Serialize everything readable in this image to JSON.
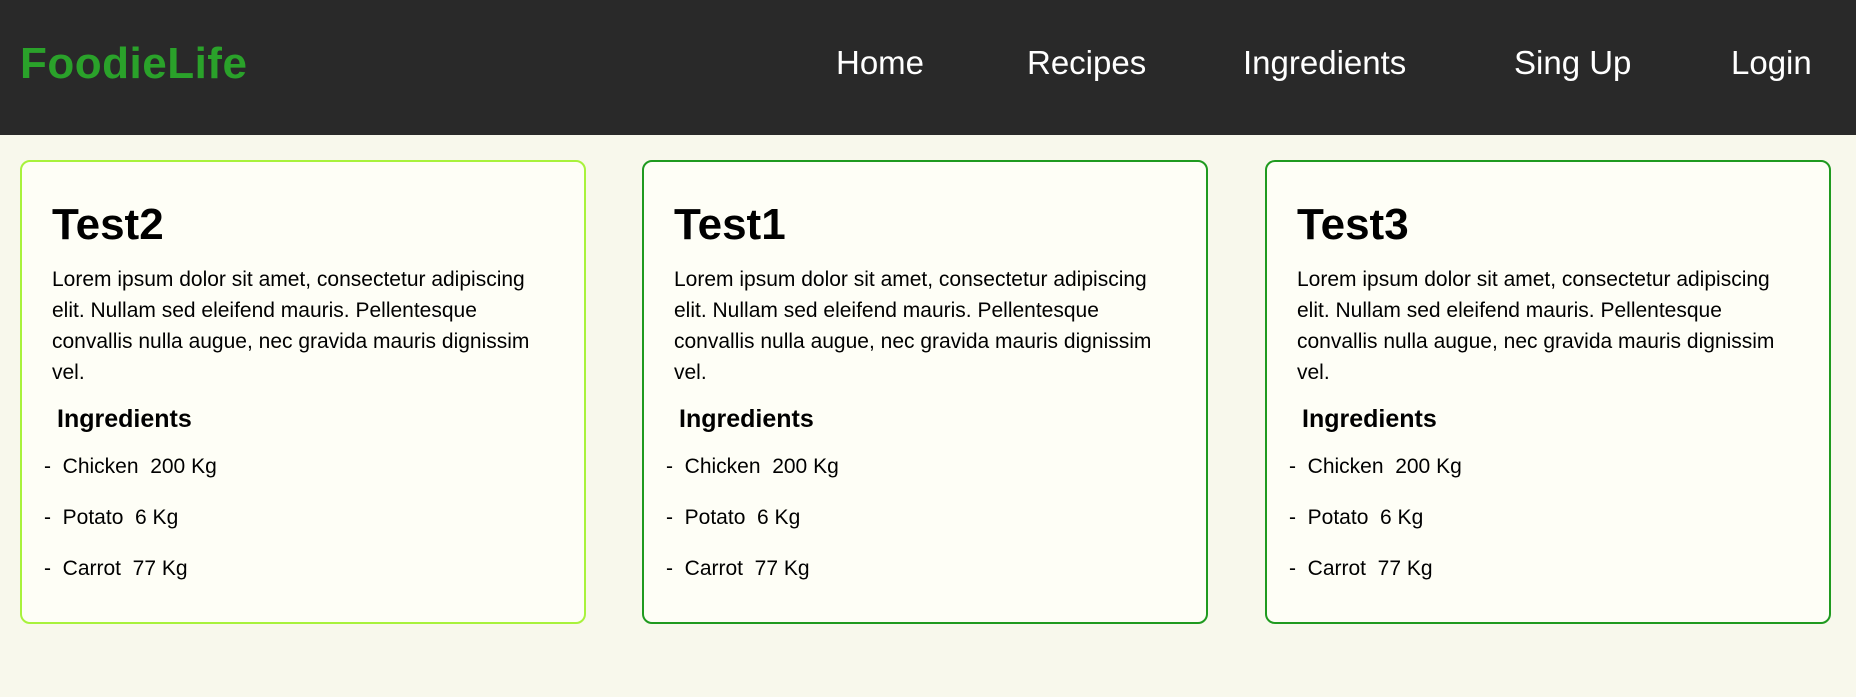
{
  "brand": {
    "name": "FoodieLife",
    "color": "#2aa22a"
  },
  "nav": {
    "home": "Home",
    "recipes": "Recipes",
    "ingredients": "Ingredients",
    "signup": "Sing Up",
    "login": "Login"
  },
  "recipes": [
    {
      "title": "Test2",
      "description": "Lorem ipsum dolor sit amet, consectetur adipiscing elit. Nullam sed eleifend mauris. Pellentesque convallis nulla augue, nec gravida mauris dignissim vel.",
      "ingredients_heading": "Ingredients",
      "ingredients": [
        "-  Chicken  200 Kg",
        "-  Potato  6 Kg",
        "-  Carrot  77 Kg"
      ]
    },
    {
      "title": "Test1",
      "description": "Lorem ipsum dolor sit amet, consectetur adipiscing elit. Nullam sed eleifend mauris. Pellentesque convallis nulla augue, nec gravida mauris dignissim vel.",
      "ingredients_heading": "Ingredients",
      "ingredients": [
        "-  Chicken  200 Kg",
        "-  Potato  6 Kg",
        "-  Carrot  77 Kg"
      ]
    },
    {
      "title": "Test3",
      "description": "Lorem ipsum dolor sit amet, consectetur adipiscing elit. Nullam sed eleifend mauris. Pellentesque convallis nulla augue, nec gravida mauris dignissim vel.",
      "ingredients_heading": "Ingredients",
      "ingredients": [
        "-  Chicken  200 Kg",
        "-  Potato  6 Kg",
        "-  Carrot  77 Kg"
      ]
    }
  ],
  "colors": {
    "navbar_bg": "#292929",
    "page_bg": "#f8f8ec",
    "card_bg": "#fefef6",
    "card_border": "#1f9a1f",
    "card_border_active": "#a8f23c"
  }
}
